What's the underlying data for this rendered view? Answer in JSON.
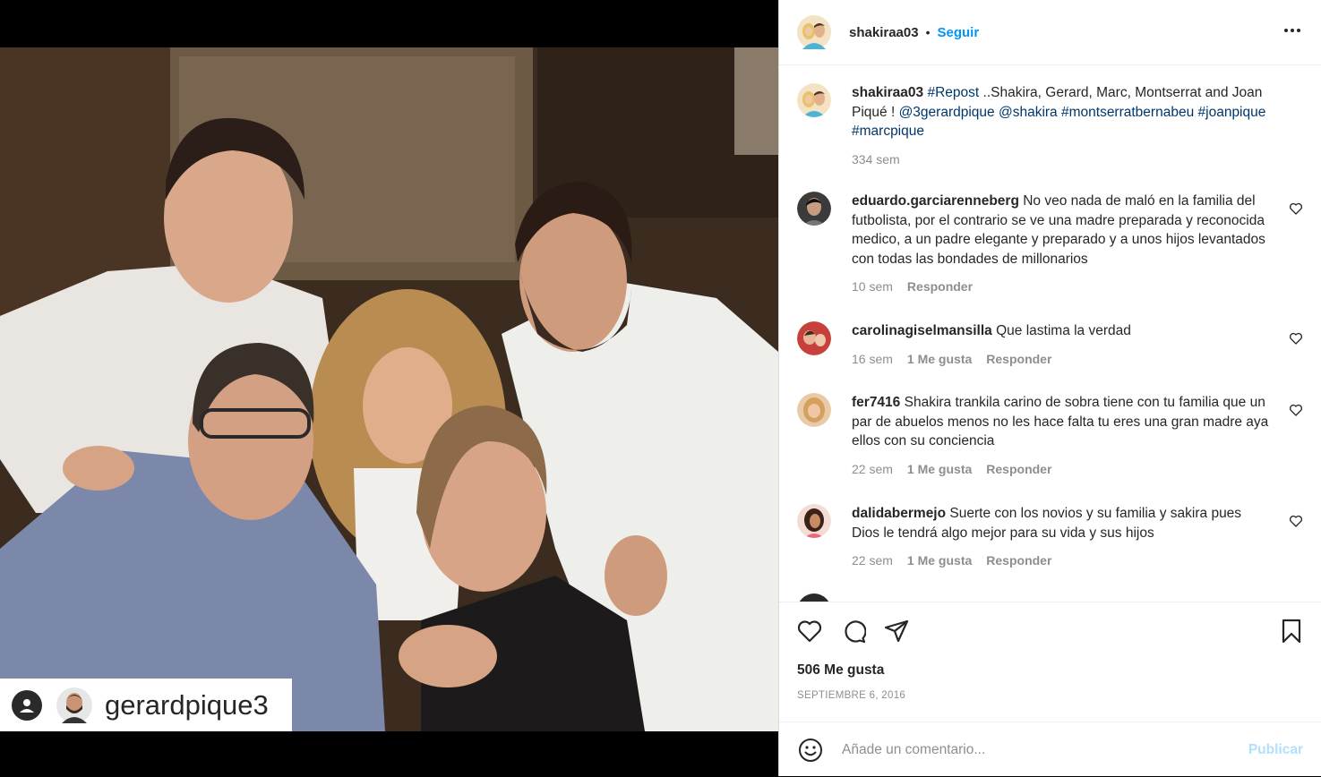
{
  "post": {
    "author": "shakiraa03",
    "follow_label": "Seguir",
    "separator": "•",
    "repost_tag_name": "gerardpique3",
    "likes": "506 Me gusta",
    "date": "SEPTIEMBRE 6, 2016"
  },
  "caption": {
    "user": "shakiraa03",
    "segments": [
      {
        "text": "#Repost",
        "type": "tag"
      },
      {
        "text": " ..Shakira, Gerard, Marc, Montserrat and Joan Piqué ! ",
        "type": "text"
      },
      {
        "text": "@3gerardpique",
        "type": "tag"
      },
      {
        "text": " ",
        "type": "text"
      },
      {
        "text": "@shakira",
        "type": "tag"
      },
      {
        "text": " ",
        "type": "text"
      },
      {
        "text": "#montserratbernabeu",
        "type": "tag"
      },
      {
        "text": " ",
        "type": "text"
      },
      {
        "text": "#joanpique",
        "type": "tag"
      },
      {
        "text": " ",
        "type": "text"
      },
      {
        "text": "#marcpique",
        "type": "tag"
      }
    ],
    "time": "334 sem"
  },
  "comments": [
    {
      "user": "eduardo.garciarenneberg",
      "text": "No veo nada de maló en la familia del futbolista, por el contrario se ve una madre preparada y reconocida medico, a un padre elegante y preparado y a unos hijos levantados con todas las bondades de millonarios",
      "time": "10 sem",
      "likes": "",
      "reply": "Responder"
    },
    {
      "user": "carolinagiselmansilla",
      "text": "Que lastima la verdad",
      "time": "16 sem",
      "likes": "1 Me gusta",
      "reply": "Responder"
    },
    {
      "user": "fer7416",
      "text": "Shakira trankila carino de sobra tiene con tu familia que un par de abuelos menos no les hace falta tu eres una gran madre aya ellos con su conciencia",
      "time": "22 sem",
      "likes": "1 Me gusta",
      "reply": "Responder"
    },
    {
      "user": "dalidabermejo",
      "text": "Suerte con los novios y su familia y sakira pues Dios le tendrá algo mejor para su vida y sus hijos",
      "time": "22 sem",
      "likes": "1 Me gusta",
      "reply": "Responder"
    }
  ],
  "composer": {
    "placeholder": "Añade un comentario...",
    "publish_label": "Publicar"
  },
  "icons": {
    "more": "more-horizontal-icon",
    "like": "heart-icon",
    "comment": "comment-bubble-icon",
    "share": "paper-plane-icon",
    "save": "bookmark-icon",
    "emoji": "emoji-smile-icon"
  },
  "colors": {
    "link_blue": "#0095f6",
    "tag_blue": "#00376b",
    "muted": "#8e8e8e",
    "publish_disabled": "#b2dffc"
  }
}
